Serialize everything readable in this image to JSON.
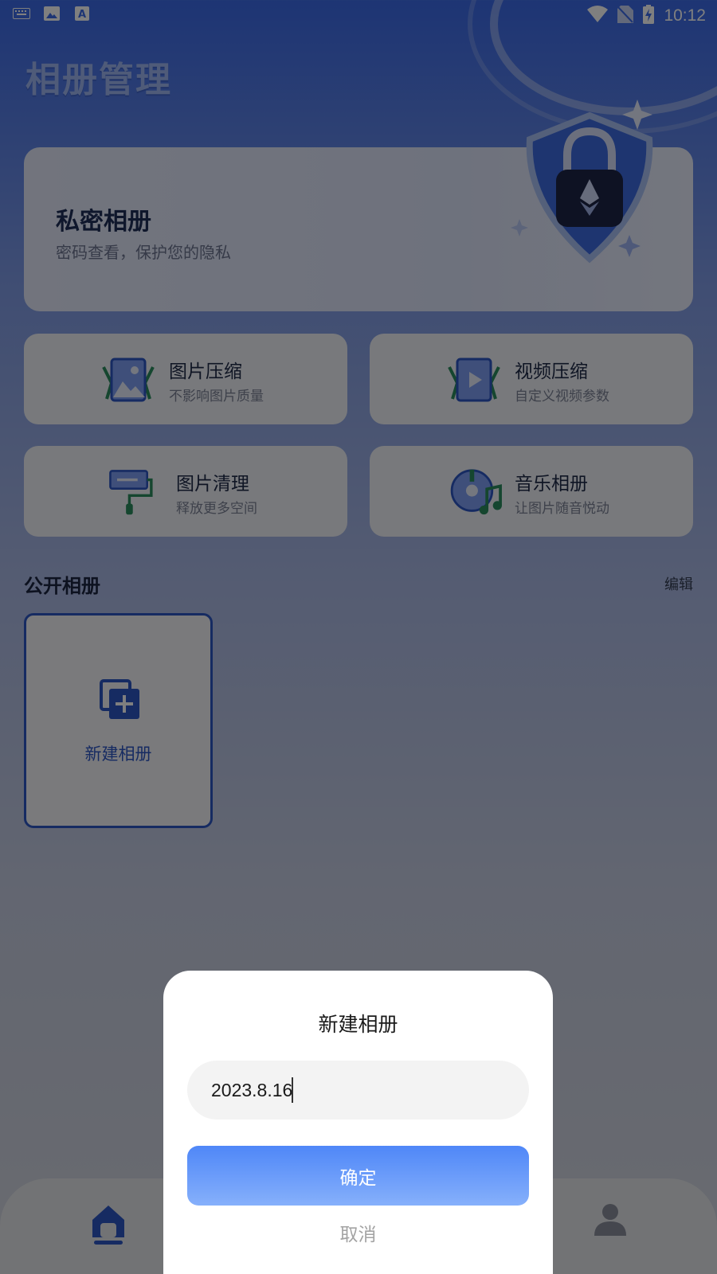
{
  "status_bar": {
    "time": "10:12",
    "left_icons": [
      "keyboard-icon",
      "image-icon",
      "font-a-icon"
    ],
    "right_icons": [
      "wifi-icon",
      "no-sim-icon",
      "battery-charging-icon"
    ]
  },
  "header": {
    "title": "相册管理"
  },
  "private_album": {
    "title": "私密相册",
    "subtitle": "密码查看，保护您的隐私",
    "art": "padlock-shield-icon"
  },
  "features": [
    {
      "title": "图片压缩",
      "subtitle": "不影响图片质量",
      "icon": "image-compress-icon"
    },
    {
      "title": "视频压缩",
      "subtitle": "自定义视频参数",
      "icon": "video-compress-icon"
    },
    {
      "title": "图片清理",
      "subtitle": "释放更多空间",
      "icon": "paint-roller-icon"
    },
    {
      "title": "音乐相册",
      "subtitle": "让图片随音悦动",
      "icon": "music-disc-icon"
    }
  ],
  "public_albums": {
    "title": "公开相册",
    "edit_label": "编辑",
    "new_album_label": "新建相册"
  },
  "bottom_nav": {
    "items": [
      "home-icon",
      "user-icon"
    ]
  },
  "dialog": {
    "title": "新建相册",
    "input_value": "2023.8.16",
    "confirm_label": "确定",
    "cancel_label": "取消"
  },
  "colors": {
    "accent_blue": "#2d56c5",
    "button_gradient_top": "#4f87f8",
    "button_gradient_bottom": "#86b0fb",
    "overlay": "rgba(0,0,0,0.5)"
  }
}
